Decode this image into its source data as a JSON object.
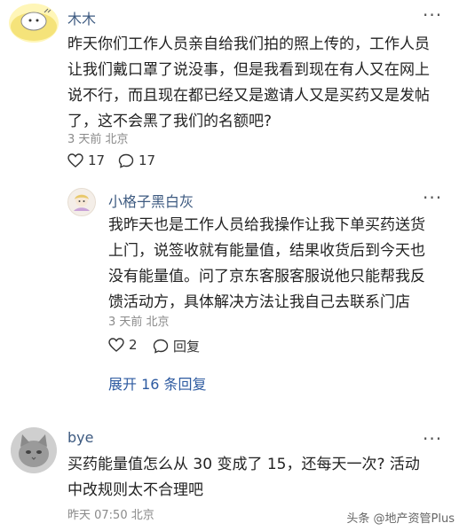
{
  "comments": [
    {
      "username": "木木",
      "text_lines": [
        "昨天你们工作人员亲自给我们拍的照上传的，工作人员",
        "让我们戴口罩了说没事，但是我看到现在有人又在网上",
        "说不行，而且现在都已经又是邀请人又是买药又是发帖",
        "了，这不会黑了我们的名额吧?"
      ],
      "meta": "3 天前 北京",
      "likes": "17",
      "replies": "17"
    },
    {
      "username": "小格子黑白灰",
      "text_lines": [
        "我昨天也是工作人员给我操作让我下单买药送货",
        "上门，说签收就有能量值，结果收货后到今天也",
        "没有能量值。问了京东客服客服说他只能帮我反",
        "馈活动方，具体解决方法让我自己去联系门店"
      ],
      "meta": "3 天前 北京",
      "likes": "2",
      "reply_label": "回复"
    },
    {
      "username": "bye",
      "text_lines": [
        "买药能量值怎么从 30 变成了 15，还每天一次? 活动",
        "中改规则太不合理吧"
      ],
      "meta": "昨天 07:50 北京"
    }
  ],
  "expand_replies": "展开 16 条回复",
  "more_icon": "more-dots-icon",
  "watermark": "头条 @地产资管Plus"
}
